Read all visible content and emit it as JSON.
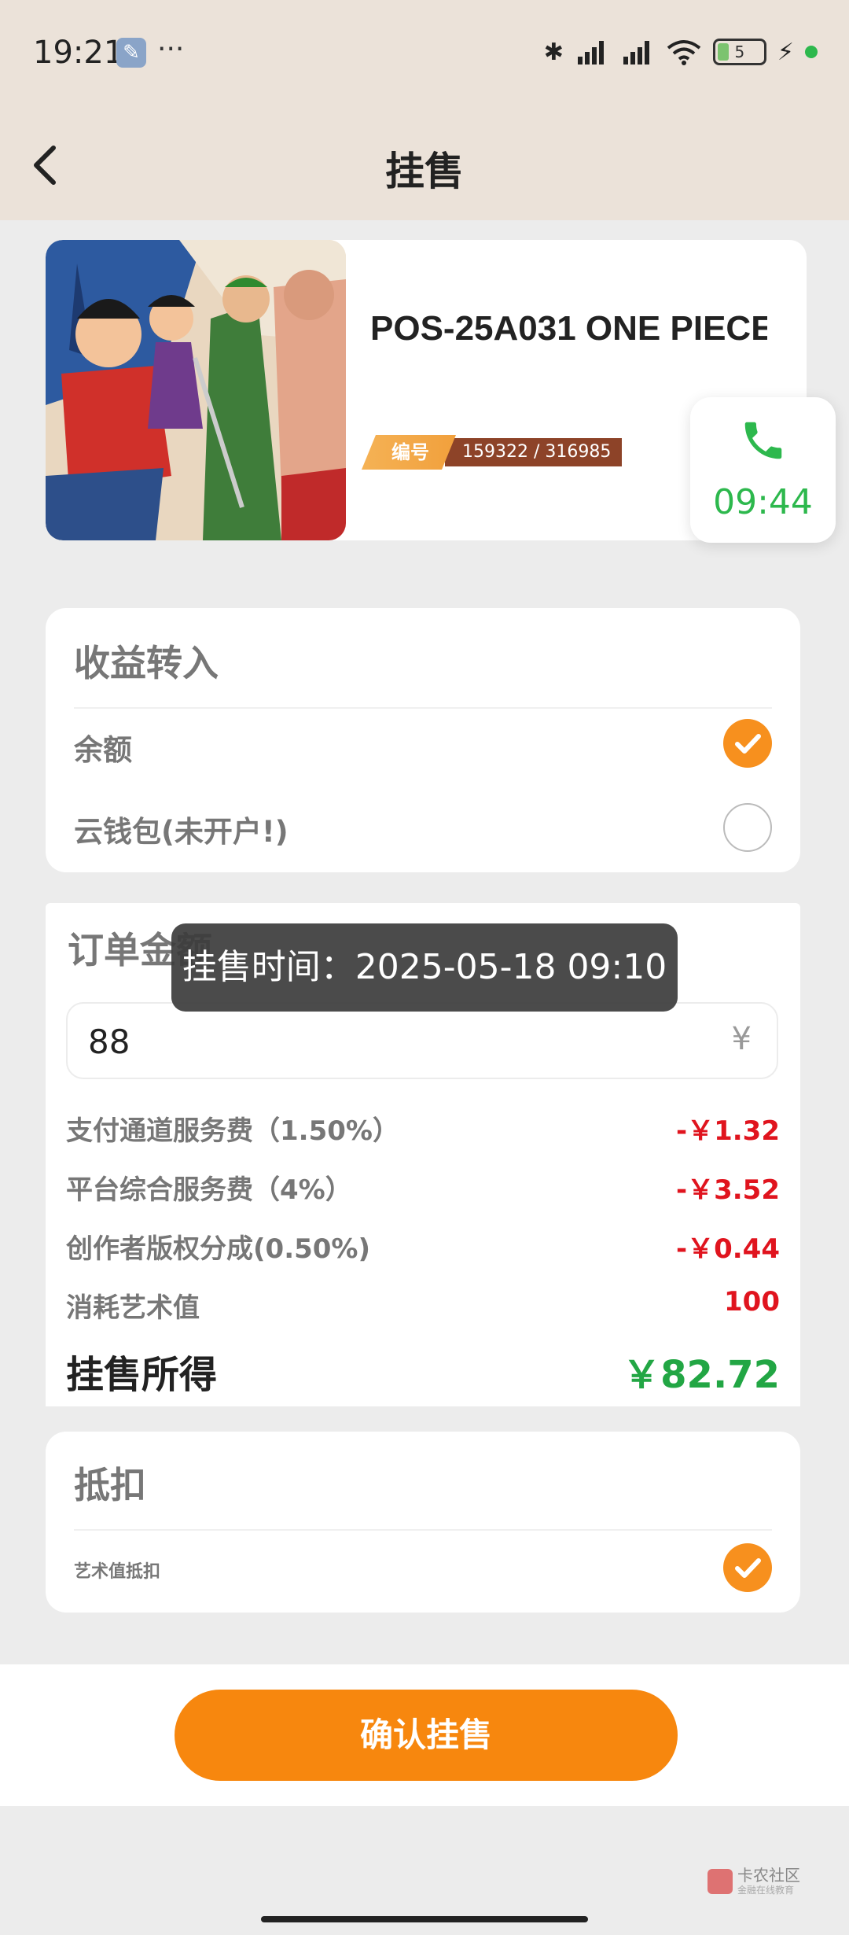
{
  "status_bar": {
    "time": "19:21",
    "more": "···",
    "battery": "5",
    "icons": [
      "wrench-icon",
      "bluetooth-icon",
      "signal-hd-icon",
      "signal-hd-icon",
      "wifi-icon",
      "battery-icon",
      "charging-icon"
    ]
  },
  "nav": {
    "title": "挂售"
  },
  "product": {
    "name": "POS-25A031 ONE PIECE",
    "serial_label": "编号",
    "serial_value": "159322 / 316985"
  },
  "call": {
    "timer": "09:44"
  },
  "income": {
    "title": "收益转入",
    "options": [
      {
        "label": "余额",
        "checked": true
      },
      {
        "label": "云钱包(未开户!)",
        "checked": false
      }
    ]
  },
  "order": {
    "title": "订单金额",
    "amount": "88",
    "currency_symbol": "¥",
    "fees": [
      {
        "label": "支付通道服务费（1.50%）",
        "value": "-￥1.32"
      },
      {
        "label": "平台综合服务费（4%）",
        "value": "-￥3.52"
      },
      {
        "label": "创作者版权分成(0.50%)",
        "value": "-￥0.44"
      },
      {
        "label": "消耗艺术值",
        "value": "100"
      }
    ],
    "proceeds_label": "挂售所得",
    "proceeds_value": "￥82.72"
  },
  "toast": {
    "text": "挂售时间：2025-05-18 09:10"
  },
  "deduction": {
    "title": "抵扣",
    "option_label": "艺术值抵扣",
    "checked": true
  },
  "confirm": {
    "label": "确认挂售"
  },
  "watermark": {
    "main": "卡农社区",
    "sub": "金融在线教育"
  },
  "colors": {
    "accent": "#f7870e",
    "negative": "#e0141e",
    "positive": "#22a644",
    "header_bg": "#ebe2d9"
  }
}
